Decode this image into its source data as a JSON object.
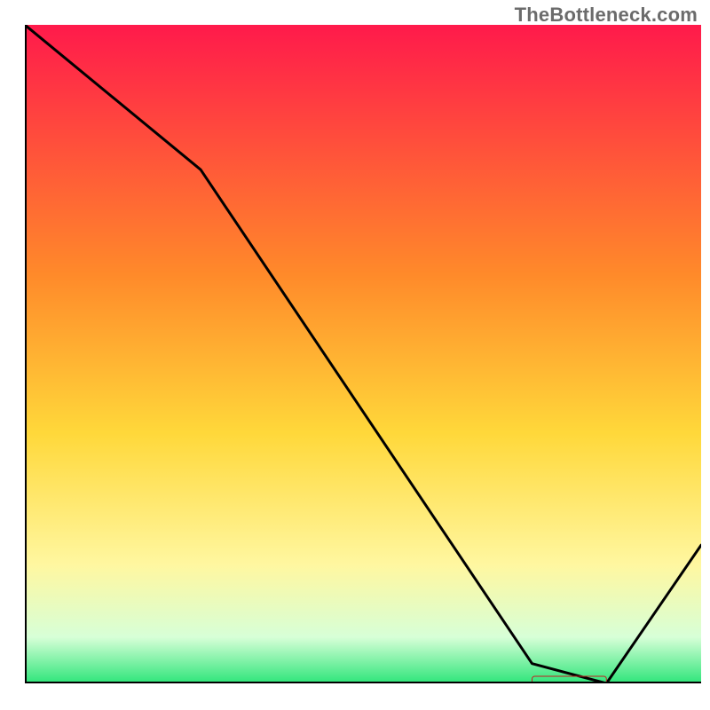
{
  "watermark": "TheBottleneck.com",
  "colors": {
    "grad_top": "#ff1a4b",
    "grad_mid_upper": "#ff8a2a",
    "grad_mid": "#ffd83a",
    "grad_mid_lower": "#fff7a0",
    "grad_near_bottom": "#d7ffd7",
    "grad_bottom": "#2ee57a",
    "marker_fill": "#ff3b3b",
    "marker_stroke": "#c22020"
  },
  "chart_data": {
    "type": "line",
    "title": "",
    "xlabel": "",
    "ylabel": "",
    "xlim": [
      0,
      100
    ],
    "ylim": [
      0,
      100
    ],
    "x": [
      0,
      26,
      75,
      86,
      100
    ],
    "y": [
      100,
      78,
      3,
      0,
      21
    ],
    "marker": {
      "x_start": 75,
      "x_end": 86,
      "y": 0
    }
  }
}
